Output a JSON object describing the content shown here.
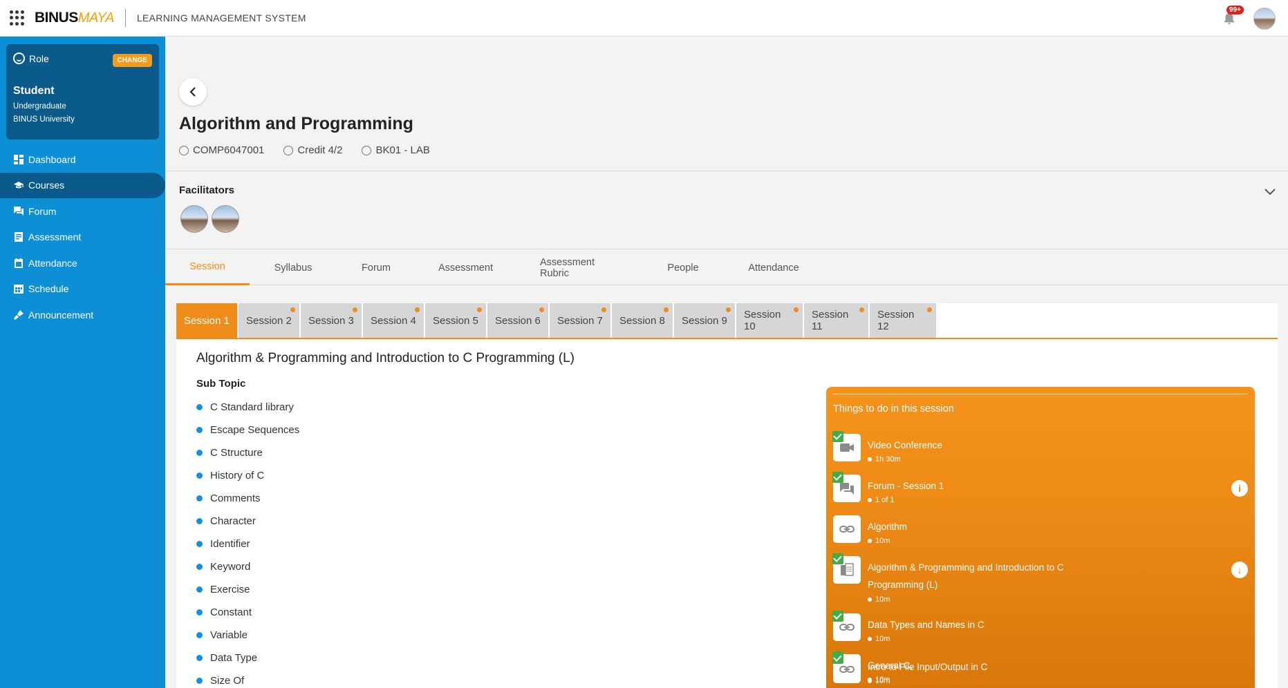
{
  "header": {
    "logo_primary": "BINUS",
    "logo_secondary": "MAYA",
    "app_title": "LEARNING MANAGEMENT SYSTEM",
    "notification_count": "99+"
  },
  "sidebar": {
    "role": {
      "label": "Role",
      "change_label": "CHANGE",
      "name": "Student",
      "level": "Undergraduate",
      "institution": "BINUS University"
    },
    "items": [
      {
        "label": "Dashboard",
        "icon": "dashboard-icon"
      },
      {
        "label": "Courses",
        "icon": "graduation-cap-icon",
        "active": true
      },
      {
        "label": "Forum",
        "icon": "forum-icon"
      },
      {
        "label": "Assessment",
        "icon": "assessment-icon"
      },
      {
        "label": "Attendance",
        "icon": "attendance-icon"
      },
      {
        "label": "Schedule",
        "icon": "schedule-icon"
      },
      {
        "label": "Announcement",
        "icon": "announcement-icon"
      }
    ]
  },
  "course": {
    "title": "Algorithm and Programming",
    "code": "COMP6047001",
    "credit": "Credit 4/2",
    "class": "BK01 - LAB"
  },
  "facilitators": {
    "title": "Facilitators"
  },
  "tabs": [
    "Session",
    "Syllabus",
    "Forum",
    "Assessment",
    "Assessment Rubric",
    "People",
    "Attendance"
  ],
  "active_tab": "Session",
  "sessions": [
    "Session 1",
    "Session 2",
    "Session 3",
    "Session 4",
    "Session 5",
    "Session 6",
    "Session 7",
    "Session 8",
    "Session 9",
    "Session 10",
    "Session 11",
    "Session 12"
  ],
  "active_session": "Session 1",
  "session_content": {
    "title": "Algorithm & Programming and Introduction to C Programming (L)",
    "subtopic_label": "Sub Topic",
    "subtopics": [
      "C Standard library",
      "Escape Sequences",
      "C Structure",
      "History of C",
      "Comments",
      "Character",
      "Identifier",
      "Keyword",
      "Exercise",
      "Constant",
      "Variable",
      "Data Type",
      "Size Of"
    ]
  },
  "todo": {
    "title": "Things to do in this session",
    "items": [
      {
        "name": "Video Conference",
        "duration": "1h 30m",
        "icon": "video-icon",
        "done": true
      },
      {
        "name": "Forum - Session 1",
        "duration": "1 of 1",
        "icon": "forum-icon",
        "done": true,
        "action": "info-icon"
      },
      {
        "name": "Algorithm",
        "duration": "10m",
        "icon": "link-icon",
        "done": false
      },
      {
        "name": "Algorithm & Programming and Introduction to C Programming (L)",
        "duration": "10m",
        "icon": "document-icon",
        "done": true,
        "action": "download-icon"
      },
      {
        "name": "Data Types and Names in C",
        "duration": "10m",
        "icon": "link-icon",
        "done": true
      },
      {
        "name": "General C,",
        "duration": "10m",
        "icon": "link-icon",
        "done": true
      },
      {
        "name": "Intro to File Input/Output in C",
        "duration": "10m",
        "icon": "link-icon",
        "done": true
      }
    ]
  },
  "colors": {
    "sidebar": "#0d8fd6",
    "sidebar_active": "#0a5a8c",
    "accent_orange": "#f08c1a",
    "check_green": "#3fae49"
  }
}
